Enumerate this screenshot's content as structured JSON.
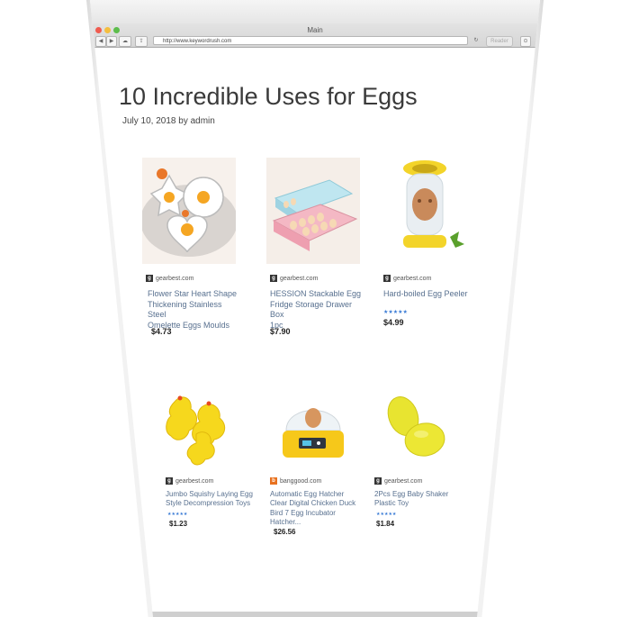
{
  "browser": {
    "window_title": "Main",
    "url": "http://www.keywordrush.com",
    "reader_label": "Reader"
  },
  "post": {
    "title": "10 Incredible Uses for Eggs",
    "meta": "July 10, 2018 by admin"
  },
  "products": [
    {
      "source": "gearbest.com",
      "name_lines": [
        "Flower Star Heart Shape",
        "Thickening Stainless Steel",
        "Omelette Eggs Moulds"
      ],
      "stars": "",
      "price": "$4.73",
      "icon": "fried-egg-mould-image"
    },
    {
      "source": "gearbest.com",
      "name_lines": [
        "HESSION Stackable Egg",
        "Fridge Storage Drawer Box",
        "1pc"
      ],
      "stars": "",
      "price": "$7.90",
      "icon": "egg-storage-box-image"
    },
    {
      "source": "gearbest.com",
      "name_lines": [
        "Hard-boiled Egg Peeler"
      ],
      "stars": "★★★★★",
      "price": "$4.99",
      "icon": "egg-peeler-image"
    },
    {
      "source": "gearbest.com",
      "name_lines": [
        "Jumbo Squishy Laying Egg",
        "Style Decompression Toys"
      ],
      "stars": "★★★★★",
      "price": "$1.23",
      "icon": "squishy-chicken-image"
    },
    {
      "source": "banggood.com",
      "name_lines": [
        "Automatic Egg Hatcher",
        "Clear Digital Chicken Duck",
        "Bird 7 Egg Incubator",
        "Hatcher..."
      ],
      "stars": "",
      "price": "$26.56",
      "icon": "egg-incubator-image"
    },
    {
      "source": "gearbest.com",
      "name_lines": [
        "2Pcs Egg Baby Shaker",
        "Plastic Toy"
      ],
      "stars": "★★★★★",
      "price": "$1.84",
      "icon": "egg-shaker-image"
    }
  ]
}
